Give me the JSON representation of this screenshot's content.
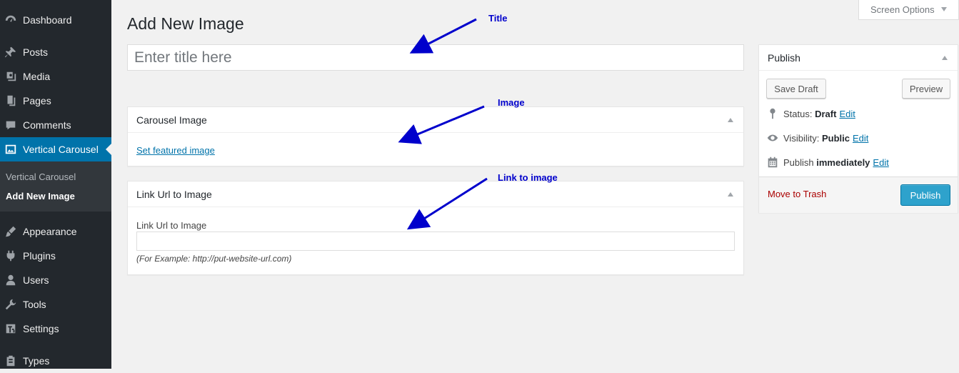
{
  "sidebar": {
    "items": [
      {
        "label": "Dashboard",
        "icon": "dashboard-icon"
      },
      {
        "label": "Posts",
        "icon": "pin-icon"
      },
      {
        "label": "Media",
        "icon": "media-icon"
      },
      {
        "label": "Pages",
        "icon": "pages-icon"
      },
      {
        "label": "Comments",
        "icon": "comments-icon"
      },
      {
        "label": "Vertical Carousel",
        "icon": "image-icon",
        "current": true
      },
      {
        "label": "Appearance",
        "icon": "brush-icon"
      },
      {
        "label": "Plugins",
        "icon": "plugin-icon"
      },
      {
        "label": "Users",
        "icon": "user-icon"
      },
      {
        "label": "Tools",
        "icon": "wrench-icon"
      },
      {
        "label": "Settings",
        "icon": "settings-icon"
      },
      {
        "label": "Types",
        "icon": "types-icon"
      }
    ],
    "submenu": [
      {
        "label": "Vertical Carousel"
      },
      {
        "label": "Add New Image",
        "current": true
      }
    ]
  },
  "screen_options": {
    "label": "Screen Options"
  },
  "page_title": "Add New Image",
  "title_field": {
    "placeholder": "Enter title here",
    "value": ""
  },
  "carousel_box": {
    "title": "Carousel Image",
    "link": "Set featured image"
  },
  "link_box": {
    "title": "Link Url to Image",
    "field_label": "Link Url to Image",
    "value": "",
    "hint": "(For Example: http://put-website-url.com)"
  },
  "publish_box": {
    "title": "Publish",
    "save_draft": "Save Draft",
    "preview": "Preview",
    "status_label": "Status:",
    "status_value": "Draft",
    "visibility_label": "Visibility:",
    "visibility_value": "Public",
    "publish_label": "Publish",
    "publish_value": "immediately",
    "edit": "Edit",
    "trash": "Move to Trash",
    "publish_button": "Publish"
  },
  "annotations": [
    {
      "text": "Title"
    },
    {
      "text": "Image"
    },
    {
      "text": "Link to image"
    }
  ],
  "colors": {
    "sidebar_bg": "#23282d",
    "current_menu": "#0073aa",
    "link": "#0073aa",
    "trash": "#a00",
    "publish_button": "#2ea2cc",
    "annotation": "#0000cc"
  }
}
